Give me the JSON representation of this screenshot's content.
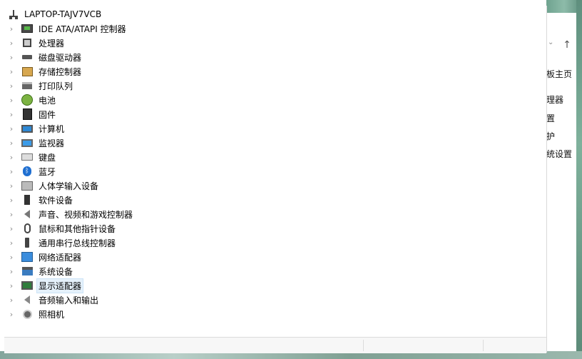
{
  "tree": {
    "root": "LAPTOP-TAJV7VCB",
    "items": [
      {
        "label": "IDE ATA/ATAPI 控制器",
        "icon": "ide-controller-icon"
      },
      {
        "label": "处理器",
        "icon": "processor-icon"
      },
      {
        "label": "磁盘驱动器",
        "icon": "disk-drive-icon"
      },
      {
        "label": "存储控制器",
        "icon": "storage-controller-icon"
      },
      {
        "label": "打印队列",
        "icon": "printer-icon"
      },
      {
        "label": "电池",
        "icon": "battery-icon"
      },
      {
        "label": "固件",
        "icon": "firmware-icon"
      },
      {
        "label": "计算机",
        "icon": "computer-icon"
      },
      {
        "label": "监视器",
        "icon": "monitor-icon"
      },
      {
        "label": "键盘",
        "icon": "keyboard-icon"
      },
      {
        "label": "蓝牙",
        "icon": "bluetooth-icon"
      },
      {
        "label": "人体学输入设备",
        "icon": "hid-icon"
      },
      {
        "label": "软件设备",
        "icon": "software-device-icon"
      },
      {
        "label": "声音、视频和游戏控制器",
        "icon": "sound-icon"
      },
      {
        "label": "鼠标和其他指针设备",
        "icon": "mouse-icon"
      },
      {
        "label": "通用串行总线控制器",
        "icon": "usb-icon"
      },
      {
        "label": "网络适配器",
        "icon": "network-adapter-icon"
      },
      {
        "label": "系统设备",
        "icon": "system-device-icon"
      },
      {
        "label": "显示适配器",
        "icon": "display-adapter-icon",
        "selected": true
      },
      {
        "label": "音频输入和输出",
        "icon": "audio-io-icon"
      },
      {
        "label": "照相机",
        "icon": "camera-icon"
      }
    ]
  },
  "background_panel": {
    "items": [
      "板主页",
      "理器",
      "置",
      "护",
      "统设置"
    ]
  },
  "glyphs": {
    "expand": "›",
    "up_arrow": "↑",
    "dropdown": "⌄",
    "bluetooth": "ᛒ"
  }
}
